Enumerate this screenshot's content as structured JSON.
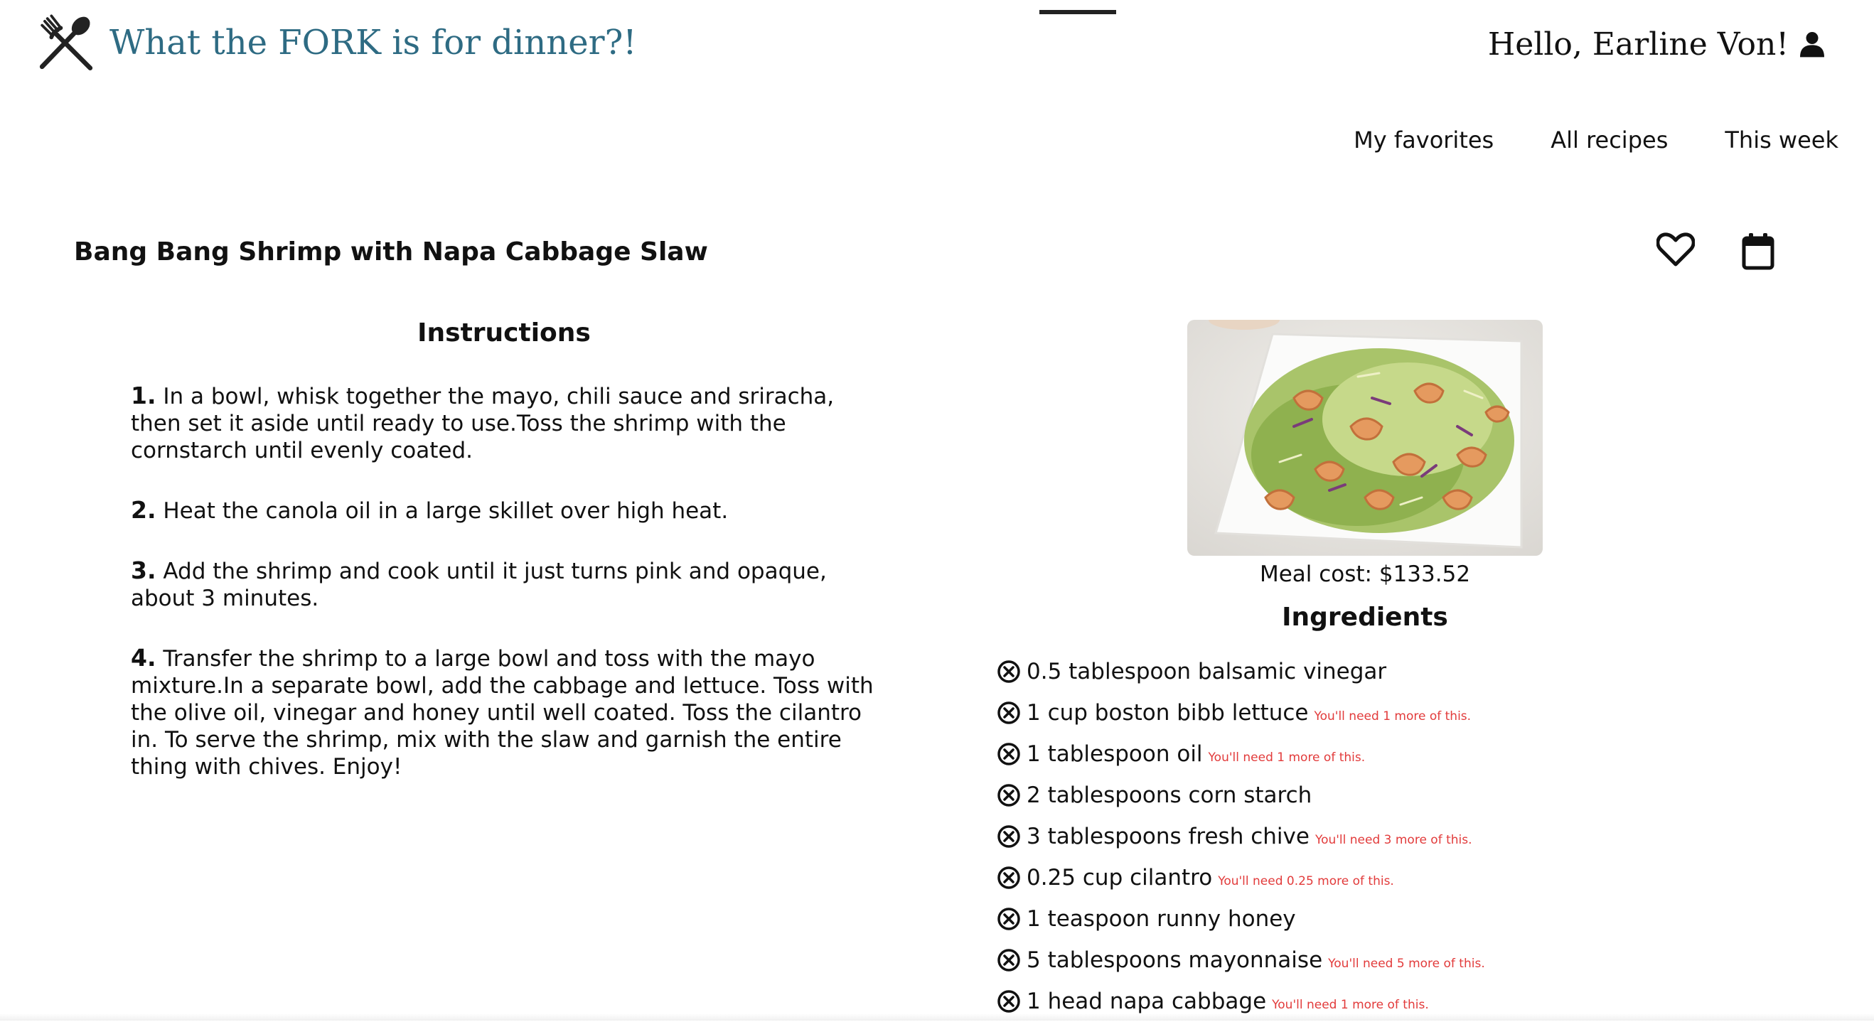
{
  "header": {
    "brand_title": "What the FORK is for dinner?!",
    "logo_icon": "fork-spoon-crossed-icon",
    "greeting": "Hello, Earline Von!",
    "user_icon": "user-icon"
  },
  "nav": {
    "items": [
      {
        "label": "My favorites"
      },
      {
        "label": "All recipes"
      },
      {
        "label": "This week"
      }
    ]
  },
  "recipe": {
    "title": "Bang Bang Shrimp with Napa Cabbage Slaw",
    "favorite_icon": "heart-outline-icon",
    "calendar_icon": "calendar-icon",
    "instructions_heading": "Instructions",
    "steps": [
      {
        "num": "1.",
        "text": "In a bowl, whisk together the mayo, chili sauce and sriracha, then set it aside until ready to use.Toss the shrimp with the cornstarch until evenly coated."
      },
      {
        "num": "2.",
        "text": "Heat the canola oil in a large skillet over high heat."
      },
      {
        "num": "3.",
        "text": "Add the shrimp and cook until it just turns pink and opaque, about 3 minutes."
      },
      {
        "num": "4.",
        "text": "Transfer the shrimp to a large bowl and toss with the mayo mixture.In a separate bowl, add the cabbage and lettuce. Toss with the olive oil, vinegar and honey until well coated. Toss the cilantro in. To serve the shrimp, mix with the slaw and garnish the entire thing with chives. Enjoy!"
      }
    ],
    "meal_cost": "Meal cost: $133.52",
    "ingredients_heading": "Ingredients",
    "ingredients": [
      {
        "text": "0.5 tablespoon balsamic vinegar",
        "note": ""
      },
      {
        "text": "1 cup boston bibb lettuce",
        "note": "You'll need 1 more of this."
      },
      {
        "text": "1 tablespoon oil",
        "note": "You'll need 1 more of this."
      },
      {
        "text": "2 tablespoons corn starch",
        "note": ""
      },
      {
        "text": "3 tablespoons fresh chive",
        "note": "You'll need 3 more of this."
      },
      {
        "text": "0.25 cup cilantro",
        "note": "You'll need 0.25 more of this."
      },
      {
        "text": "1 teaspoon runny honey",
        "note": ""
      },
      {
        "text": "5 tablespoons mayonnaise",
        "note": "You'll need 5 more of this."
      },
      {
        "text": "1 head napa cabbage",
        "note": "You'll need 1 more of this."
      }
    ]
  },
  "colors": {
    "brand": "#2e6b83",
    "warning": "#e23b3b",
    "text": "#111111"
  }
}
